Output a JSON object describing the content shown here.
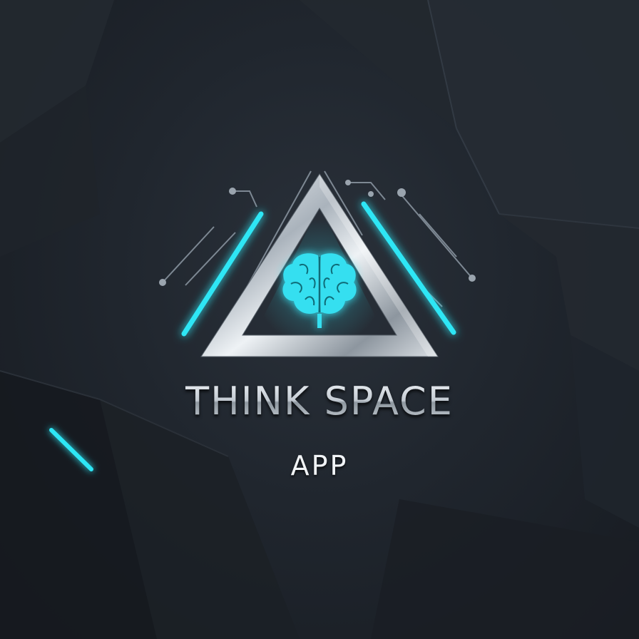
{
  "logo": {
    "title": "THINK SPACE",
    "subtitle": "APP",
    "icon": "brain-in-triangle-icon"
  },
  "colors": {
    "background": "#1c2128",
    "accent_cyan": "#2ee6f5",
    "silver": "#d7dde3",
    "brain": "#34dff0"
  }
}
